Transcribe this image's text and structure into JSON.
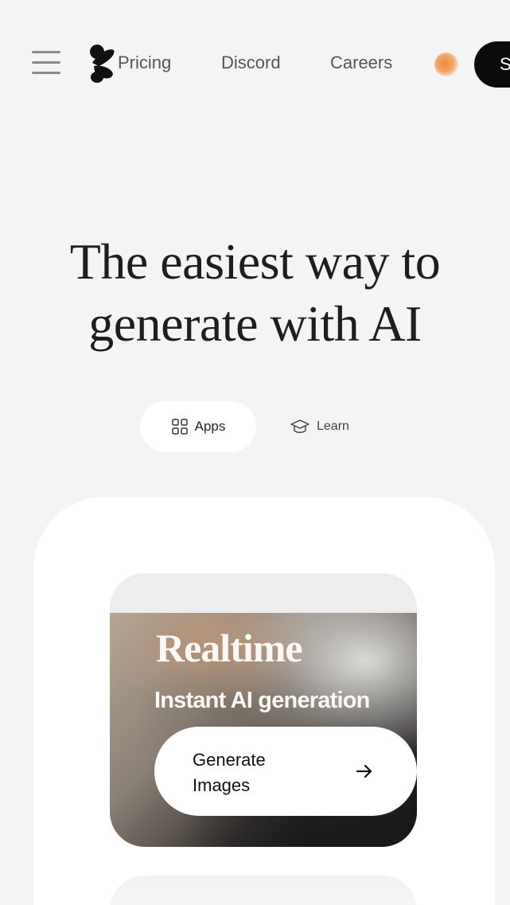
{
  "nav": {
    "links": [
      "Pricing",
      "Discord",
      "Careers"
    ],
    "cta_label": "Sign up"
  },
  "hero": {
    "title_line1": "The easiest way to",
    "title_line2": "generate with AI"
  },
  "tabs": {
    "apps_label": "Apps",
    "learn_label": "Learn"
  },
  "feature": {
    "title": "Realtime",
    "subtitle": "Instant AI generation",
    "button_line1": "Generate",
    "button_line2": "Images"
  },
  "icons": {
    "menu": "hamburger-icon",
    "logo": "krea-logo-icon",
    "apps": "grid-icon",
    "learn": "graduation-cap-icon",
    "arrow": "arrow-right-icon"
  },
  "colors": {
    "background": "#f4f4f4",
    "cta": "#0b0b0b",
    "accent_orb": "#f08a3a",
    "card": "#ffffff"
  }
}
